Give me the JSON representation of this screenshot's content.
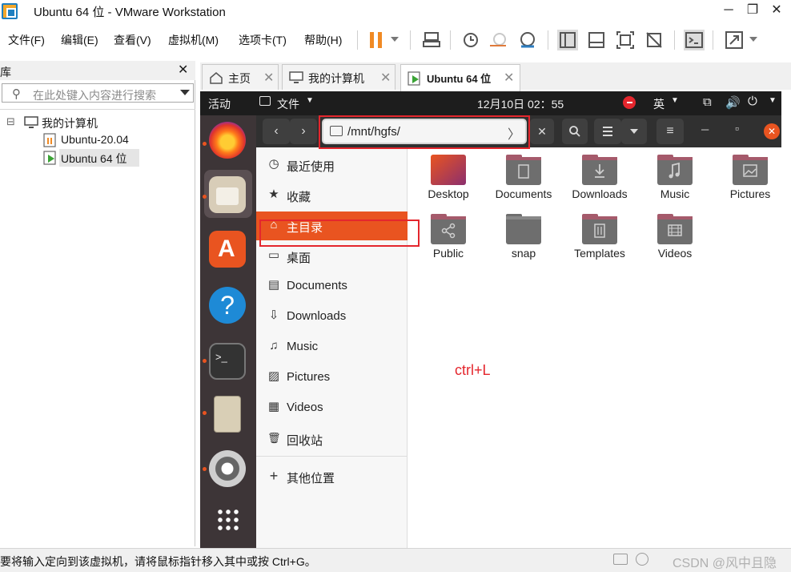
{
  "window": {
    "title": "Ubuntu 64 位 - VMware Workstation",
    "minimize": "─",
    "maximize": "❐",
    "close": "✕"
  },
  "menu": [
    "文件(F)",
    "编辑(E)",
    "查看(V)",
    "虚拟机(M)",
    "选项卡(T)",
    "帮助(H)"
  ],
  "library": {
    "title": "库",
    "close": "✕",
    "search_placeholder": "在此处键入内容进行搜索",
    "tree": [
      {
        "label": "我的计算机",
        "toggle": "⊟"
      },
      {
        "label": "Ubuntu-20.04"
      },
      {
        "label": "Ubuntu 64 位"
      }
    ]
  },
  "tabs": [
    {
      "label": "主页"
    },
    {
      "label": "我的计算机"
    },
    {
      "label": "Ubuntu 64 位"
    }
  ],
  "tab_close": "✕",
  "ubuntu": {
    "activities": "活动",
    "app_menu": "文件",
    "clock": "12月10日  02：55",
    "input_method": "英",
    "headerbar": {
      "path": "/mnt/hgfs/",
      "back": "‹",
      "forward": "›",
      "path_chevron": "〉",
      "clear": "✕",
      "menu": "≡",
      "minimize": "─",
      "restore": "▫",
      "close": "✕"
    },
    "sidebar": [
      {
        "label": "最近使用",
        "icon": "clock-icon",
        "glyph": "◷"
      },
      {
        "label": "收藏",
        "icon": "star-icon",
        "glyph": "★"
      },
      {
        "label": "主目录",
        "icon": "home-icon",
        "glyph": "⌂",
        "active": true
      },
      {
        "label": "桌面",
        "icon": "desktop-icon",
        "glyph": "▭"
      },
      {
        "label": "Documents",
        "icon": "document-icon",
        "glyph": "▤"
      },
      {
        "label": "Downloads",
        "icon": "download-icon",
        "glyph": "⇩"
      },
      {
        "label": "Music",
        "icon": "music-icon",
        "glyph": "♫"
      },
      {
        "label": "Pictures",
        "icon": "picture-icon",
        "glyph": "▨"
      },
      {
        "label": "Videos",
        "icon": "video-icon",
        "glyph": "▦"
      },
      {
        "label": "回收站",
        "icon": "trash-icon",
        "glyph": "🗑"
      },
      {
        "label": "其他位置",
        "icon": "plus-icon",
        "glyph": "+"
      }
    ],
    "folders": [
      {
        "name": "Desktop",
        "glyph": ""
      },
      {
        "name": "Documents",
        "glyph": "▤"
      },
      {
        "name": "Downloads",
        "glyph": "⇩"
      },
      {
        "name": "Music",
        "glyph": "♫"
      },
      {
        "name": "Pictures",
        "glyph": "▨"
      },
      {
        "name": "Public",
        "glyph": "⋲"
      },
      {
        "name": "snap",
        "glyph": ""
      },
      {
        "name": "Templates",
        "glyph": "▥"
      },
      {
        "name": "Videos",
        "glyph": "▦"
      }
    ],
    "annotation": "ctrl+L"
  },
  "statusbar": {
    "message": "要将输入定向到该虚拟机，请将鼠标指针移入其中或按 Ctrl+G。",
    "watermark": "CSDN @风中且隐"
  },
  "colors": {
    "ubuntu_orange": "#e95420",
    "dock_bg": "#3d3537",
    "folder_top": "#a55a6b",
    "folder_body": "#6e6e6e",
    "highlight_red": "#e4262d"
  }
}
